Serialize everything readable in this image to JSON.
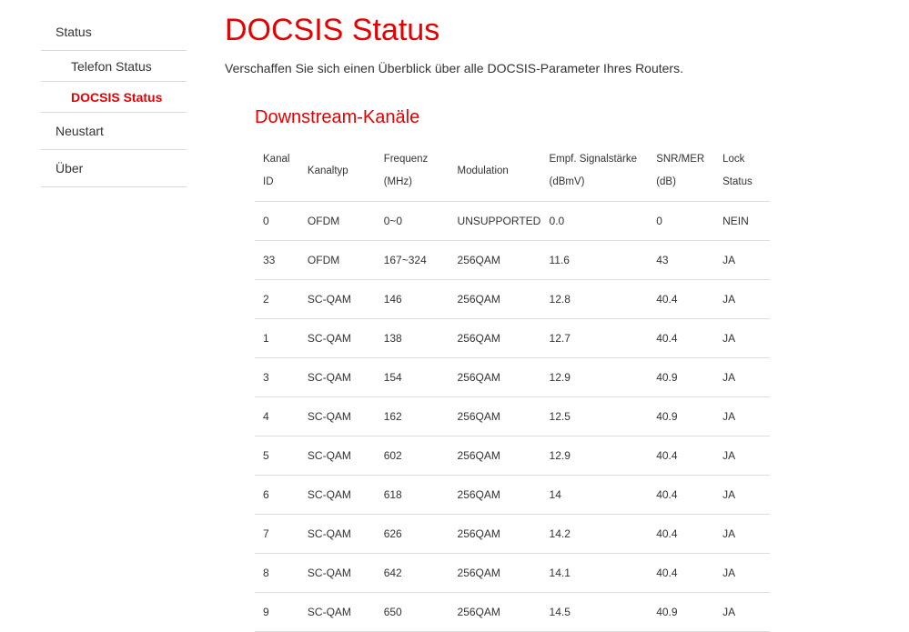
{
  "sidebar": {
    "items": [
      {
        "label": "Status"
      },
      {
        "label": "Telefon Status"
      },
      {
        "label": "DOCSIS Status"
      },
      {
        "label": "Neustart"
      },
      {
        "label": "Über"
      }
    ]
  },
  "main": {
    "title": "DOCSIS Status",
    "description": "Verschaffen Sie sich einen Überblick über alle DOCSIS-Parameter Ihres Routers.",
    "downstream": {
      "title": "Downstream-Kanäle",
      "headers": [
        [
          "Kanal",
          "ID"
        ],
        [
          "Kanaltyp"
        ],
        [
          "Frequenz",
          "(MHz)"
        ],
        [
          "Modulation"
        ],
        [
          "Empf. Signalstärke",
          "(dBmV)"
        ],
        [
          "SNR/MER",
          "(dB)"
        ],
        [
          "Lock",
          "Status"
        ]
      ],
      "rows": [
        [
          "0",
          "OFDM",
          "0~0",
          "UNSUPPORTED",
          "0.0",
          "0",
          "NEIN"
        ],
        [
          "33",
          "OFDM",
          "167~324",
          "256QAM",
          "11.6",
          "43",
          "JA"
        ],
        [
          "2",
          "SC-QAM",
          "146",
          "256QAM",
          "12.8",
          "40.4",
          "JA"
        ],
        [
          "1",
          "SC-QAM",
          "138",
          "256QAM",
          "12.7",
          "40.4",
          "JA"
        ],
        [
          "3",
          "SC-QAM",
          "154",
          "256QAM",
          "12.9",
          "40.9",
          "JA"
        ],
        [
          "4",
          "SC-QAM",
          "162",
          "256QAM",
          "12.5",
          "40.9",
          "JA"
        ],
        [
          "5",
          "SC-QAM",
          "602",
          "256QAM",
          "12.9",
          "40.4",
          "JA"
        ],
        [
          "6",
          "SC-QAM",
          "618",
          "256QAM",
          "14",
          "40.4",
          "JA"
        ],
        [
          "7",
          "SC-QAM",
          "626",
          "256QAM",
          "14.2",
          "40.4",
          "JA"
        ],
        [
          "8",
          "SC-QAM",
          "642",
          "256QAM",
          "14.1",
          "40.4",
          "JA"
        ],
        [
          "9",
          "SC-QAM",
          "650",
          "256QAM",
          "14.5",
          "40.9",
          "JA"
        ]
      ]
    }
  },
  "colors": {
    "accent": "#e60000",
    "text": "#333333",
    "divider": "#dddddd"
  }
}
